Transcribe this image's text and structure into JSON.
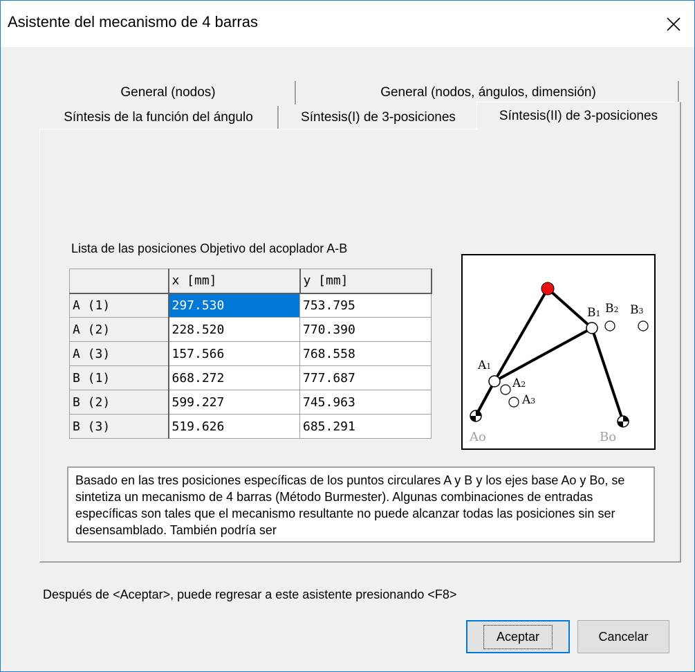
{
  "window": {
    "title": "Asistente del mecanismo de 4 barras"
  },
  "tabs": {
    "row1": [
      "General (nodos)",
      "General (nodos, ángulos, dimensión)"
    ],
    "row2": [
      "Síntesis de la función del ángulo",
      "Síntesis(I) de 3-posiciones",
      "Síntesis(II) de 3-posiciones"
    ],
    "active": "Síntesis(II) de 3-posiciones"
  },
  "positions": {
    "label": "Lista de las posiciones Objetivo del acoplador A-B",
    "headers": [
      "",
      "x [mm]",
      "y [mm]"
    ],
    "rows": [
      {
        "name": "A (1)",
        "x": "297.530",
        "y": "753.795"
      },
      {
        "name": "A (2)",
        "x": "228.520",
        "y": "770.390"
      },
      {
        "name": "A (3)",
        "x": "157.566",
        "y": "768.558"
      },
      {
        "name": "B (1)",
        "x": "668.272",
        "y": "777.687"
      },
      {
        "name": "B (2)",
        "x": "599.227",
        "y": "745.963"
      },
      {
        "name": "B (3)",
        "x": "519.626",
        "y": "685.291"
      }
    ]
  },
  "diagram": {
    "labels": {
      "A1": "A",
      "A1_sub": "1",
      "A2": "A",
      "A2_sub": "2",
      "A3": "A",
      "A3_sub": "3",
      "B1": "B",
      "B1_sub": "1",
      "B2": "B",
      "B2_sub": "2",
      "B3": "B",
      "B3_sub": "3",
      "Ao": "Ao",
      "Bo": "Bo"
    },
    "colors": {
      "coupler_point": "#e81010",
      "links": "#000000",
      "base_labels": "#a0a0a0"
    }
  },
  "description": "Basado en las tres posiciones específicas de los puntos circulares A y B y los ejes base Ao y Bo, se sintetiza un mecanismo de 4 barras (Método Burmester). Algunas combinaciones de entradas específicas son tales que el mecanismo resultante no puede alcanzar todas las posiciones sin ser desensamblado. También podría ser",
  "hint": "Después de <Aceptar>, puede regresar a este asistente presionando <F8>",
  "buttons": {
    "ok": "Aceptar",
    "cancel": "Cancelar"
  },
  "icons": {
    "close": "close-icon"
  }
}
